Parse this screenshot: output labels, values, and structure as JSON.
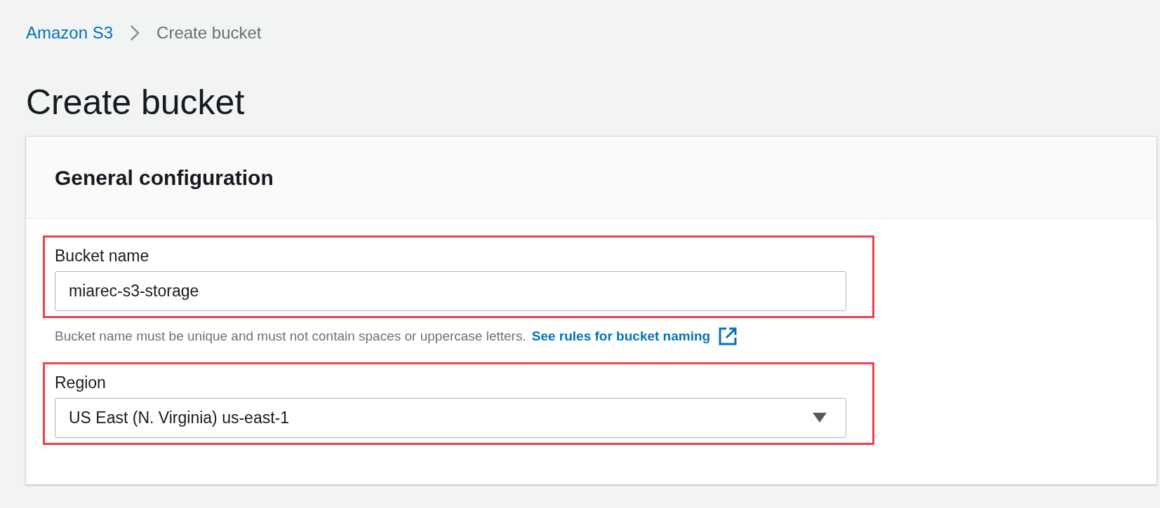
{
  "breadcrumb": [
    {
      "label": "Amazon S3",
      "kind": "link"
    },
    {
      "label": "Create bucket",
      "kind": "current"
    }
  ],
  "page_title": "Create bucket",
  "panel": {
    "title": "General configuration",
    "fields": [
      {
        "kind": "input",
        "label": "Bucket name",
        "value": "miarec-s3-storage",
        "highlighted": true,
        "hint": "Bucket name must be unique and must not contain spaces or uppercase letters.",
        "hint_link": "See rules for bucket naming"
      },
      {
        "kind": "select",
        "label": "Region",
        "value": "US East (N. Virginia) us-east-1",
        "highlighted": true
      }
    ]
  }
}
